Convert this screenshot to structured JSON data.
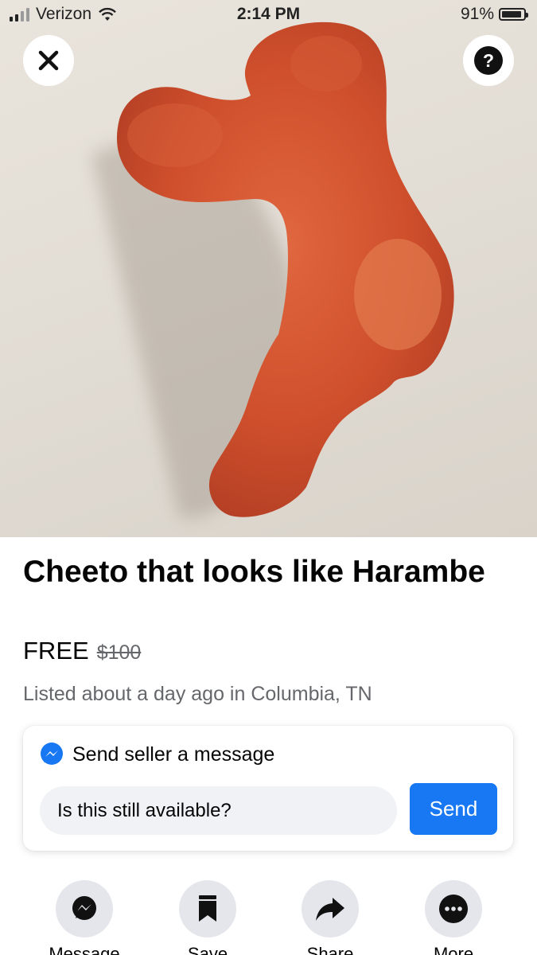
{
  "status_bar": {
    "carrier": "Verizon",
    "time": "2:14 PM",
    "battery": "91%",
    "battery_level": 0.91
  },
  "top_controls": {
    "close": "close-icon",
    "help": "help-icon"
  },
  "photo": {
    "subject": "cheeto"
  },
  "listing": {
    "title": "Cheeto that looks like Harambe",
    "price": "FREE",
    "original_price": "$100",
    "listed": "Listed about a day ago in Columbia, TN"
  },
  "message_card": {
    "header": "Send seller a message",
    "input_value": "Is this still available?",
    "send_label": "Send"
  },
  "actions": [
    {
      "label": "Message",
      "icon": "messenger-icon"
    },
    {
      "label": "Save",
      "icon": "bookmark-icon"
    },
    {
      "label": "Share",
      "icon": "share-icon"
    },
    {
      "label": "More",
      "icon": "more-icon"
    }
  ],
  "colors": {
    "accent": "#1877f2",
    "text": "#050505",
    "secondary": "#65676b",
    "action_bg": "#e4e6eb"
  }
}
